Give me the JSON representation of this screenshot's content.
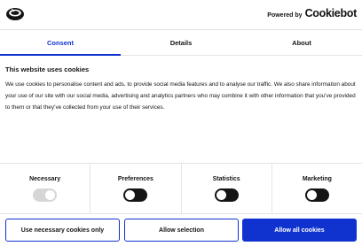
{
  "header": {
    "powered_by_label": "Powered by",
    "brand_name": "Cookiebot"
  },
  "tabs": [
    {
      "label": "Consent",
      "active": true
    },
    {
      "label": "Details",
      "active": false
    },
    {
      "label": "About",
      "active": false
    }
  ],
  "content": {
    "title": "This website uses cookies",
    "text": "We use cookies to personalise content and ads, to provide social media features and to analyse our traffic. We also share information about your use of our site with our social media, advertising and analytics partners who may combine it with other information that you’ve provided to them or that they’ve collected from your use of their services."
  },
  "toggles": [
    {
      "label": "Necessary",
      "enabled": true,
      "disabled": true
    },
    {
      "label": "Preferences",
      "enabled": false,
      "disabled": false
    },
    {
      "label": "Statistics",
      "enabled": false,
      "disabled": false
    },
    {
      "label": "Marketing",
      "enabled": false,
      "disabled": false
    }
  ],
  "buttons": {
    "necessary_only": "Use necessary cookies only",
    "allow_selection": "Allow selection",
    "allow_all": "Allow all cookies"
  },
  "colors": {
    "accent": "#1032cf",
    "text": "#141414",
    "toggle_off": "#141414",
    "toggle_disabled": "#d6d6d6"
  },
  "icons": {
    "logo": "cookie-logo-icon"
  }
}
